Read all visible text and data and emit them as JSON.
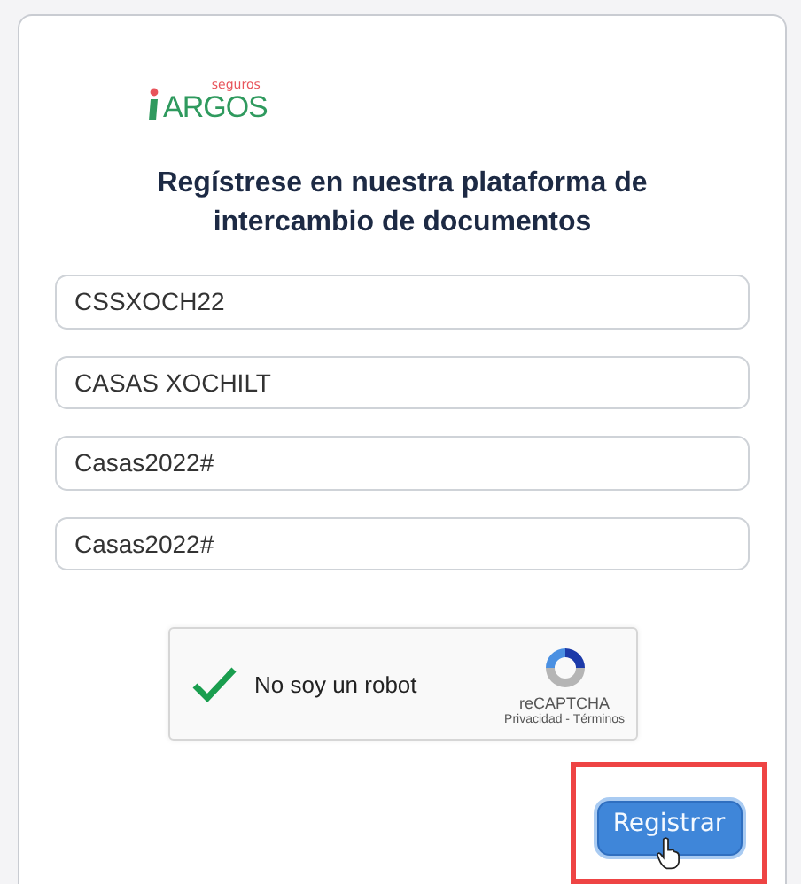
{
  "logo": {
    "small": "seguros",
    "main": "ARGOS"
  },
  "heading": "Regístrese en nuestra plataforma de intercambio de documentos",
  "fields": [
    {
      "value": "CSSXOCH22"
    },
    {
      "value": "CASAS XOCHILT"
    },
    {
      "value": "Casas2022#"
    },
    {
      "value": "Casas2022#"
    }
  ],
  "captcha": {
    "checked": true,
    "label": "No soy un robot",
    "brand": "reCAPTCHA",
    "links": "Privacidad - Términos"
  },
  "submit": {
    "label": "Registrar",
    "highlighted": true
  }
}
